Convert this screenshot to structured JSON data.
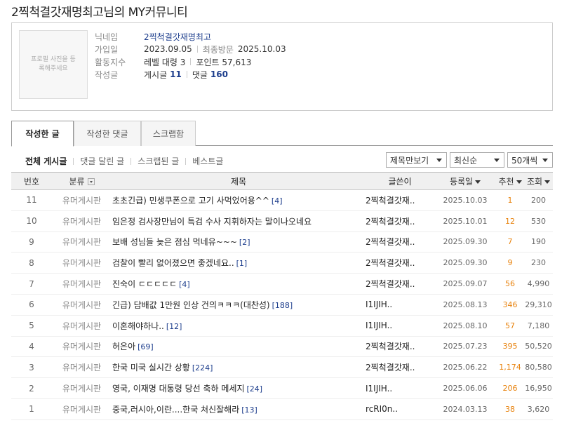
{
  "page": {
    "title": "2찍척결갓재명최고님의 MY커뮤니티"
  },
  "profile": {
    "avatar_placeholder": "프로필 사진을 등록해주세요",
    "nickname_label": "닉네임",
    "nickname": "2찍척결갓재명최고",
    "joined_label": "가입일",
    "joined": "2023.09.05",
    "last_visit_label": "최종방문",
    "last_visit": "2025.10.03",
    "activity_label": "활동지수",
    "level": "레벨 대령 3",
    "points": "포인트 57,613",
    "written_label": "작성글",
    "posts_label": "게시글",
    "posts_count": "11",
    "comments_label": "댓글",
    "comments_count": "160"
  },
  "tabs": [
    "작성한 글",
    "작성한 댓글",
    "스크랩함"
  ],
  "filters": [
    "전체 게시글",
    "댓글 달린 글",
    "스크랩된 글",
    "베스트글"
  ],
  "selects": {
    "view": "제목만보기",
    "order": "최신순",
    "per_page": "50개씩"
  },
  "columns": {
    "no": "번호",
    "category": "분류",
    "title": "제목",
    "author": "글쓴이",
    "date": "등록일",
    "recommend": "추천",
    "views": "조회"
  },
  "rows": [
    {
      "no": "11",
      "category": "유머게시판",
      "title": "초초긴급) 민생쿠폰으로 고기 사먹었어용^^",
      "comments": "[4]",
      "author": "2찍척결갓재..",
      "date": "2025.10.03",
      "recommend": "1",
      "views": "200"
    },
    {
      "no": "10",
      "category": "유머게시판",
      "title": "임은정 검사장만님이 특검 수사 지휘하자는 말이나오네요",
      "comments": "",
      "author": "2찍척결갓재..",
      "date": "2025.10.01",
      "recommend": "12",
      "views": "530"
    },
    {
      "no": "9",
      "category": "유머게시판",
      "title": "보배 성님들 늦은 점심 먹네유~~~",
      "comments": "[2]",
      "author": "2찍척결갓재..",
      "date": "2025.09.30",
      "recommend": "7",
      "views": "190"
    },
    {
      "no": "8",
      "category": "유머게시판",
      "title": "검찰이 빨리 없어졌으면 좋겠네요..",
      "comments": "[1]",
      "author": "2찍척결갓재..",
      "date": "2025.09.30",
      "recommend": "9",
      "views": "230"
    },
    {
      "no": "7",
      "category": "유머게시판",
      "title": "진숙이 ㄷㄷㄷㄷㄷ",
      "comments": "[4]",
      "author": "2찍척결갓재..",
      "date": "2025.09.07",
      "recommend": "56",
      "views": "4,990"
    },
    {
      "no": "6",
      "category": "유머게시판",
      "title": "긴급) 담배값 1만원 인상 건의ㅋㅋㅋ(대찬성)",
      "comments": "[188]",
      "author": "I1IJIH..",
      "date": "2025.08.13",
      "recommend": "346",
      "views": "29,310"
    },
    {
      "no": "5",
      "category": "유머게시판",
      "title": "이혼해야하나..",
      "comments": "[12]",
      "author": "I1IJIH..",
      "date": "2025.08.10",
      "recommend": "57",
      "views": "7,180"
    },
    {
      "no": "4",
      "category": "유머게시판",
      "title": "허은아",
      "comments": "[69]",
      "author": "2찍척결갓재..",
      "date": "2025.07.23",
      "recommend": "395",
      "views": "50,520"
    },
    {
      "no": "3",
      "category": "유머게시판",
      "title": "한국 미국 실시간 상황",
      "comments": "[224]",
      "author": "2찍척결갓재..",
      "date": "2025.06.22",
      "recommend": "1,174",
      "views": "80,580"
    },
    {
      "no": "2",
      "category": "유머게시판",
      "title": "영국, 이재명 대통령 당선 축하 메세지",
      "comments": "[24]",
      "author": "I1IJIH..",
      "date": "2025.06.06",
      "recommend": "206",
      "views": "16,950"
    },
    {
      "no": "1",
      "category": "유머게시판",
      "title": "중국,러시아,이란....한국 처신잘해라",
      "comments": "[13]",
      "author": "rcRI0n..",
      "date": "2024.03.13",
      "recommend": "38",
      "views": "3,620"
    }
  ]
}
